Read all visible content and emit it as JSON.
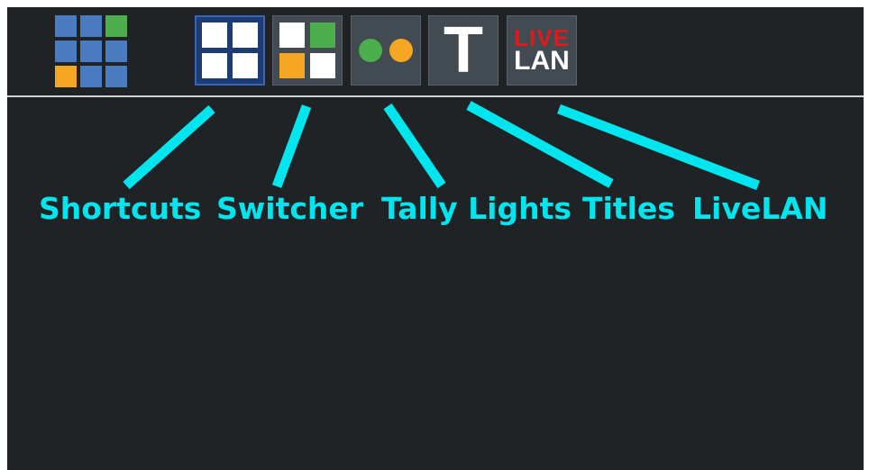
{
  "colors": {
    "panel_bg": "#1f2326",
    "accent": "#00e5ee",
    "tile_bg": "#434b52",
    "active_tile_bg": "#1d3c73",
    "blue": "#4a7bc0",
    "green": "#4cae4c",
    "orange": "#f5a623",
    "red": "#e01a1a"
  },
  "toolbar": {
    "app_grid_icon": "app-grid-icon",
    "tools": [
      {
        "id": "shortcuts",
        "icon": "shortcuts-icon",
        "active": true
      },
      {
        "id": "switcher",
        "icon": "switcher-icon",
        "active": false
      },
      {
        "id": "tally-lights",
        "icon": "tally-lights-icon",
        "active": false
      },
      {
        "id": "titles",
        "icon": "titles-icon",
        "glyph": "T",
        "active": false
      },
      {
        "id": "livelan",
        "icon": "livelan-icon",
        "logo_top": "LIVE",
        "logo_bottom": "LAN",
        "active": false
      }
    ]
  },
  "annotations": {
    "labels": [
      "Shortcuts",
      "Switcher",
      "Tally Lights",
      "Titles",
      "LiveLAN"
    ]
  }
}
